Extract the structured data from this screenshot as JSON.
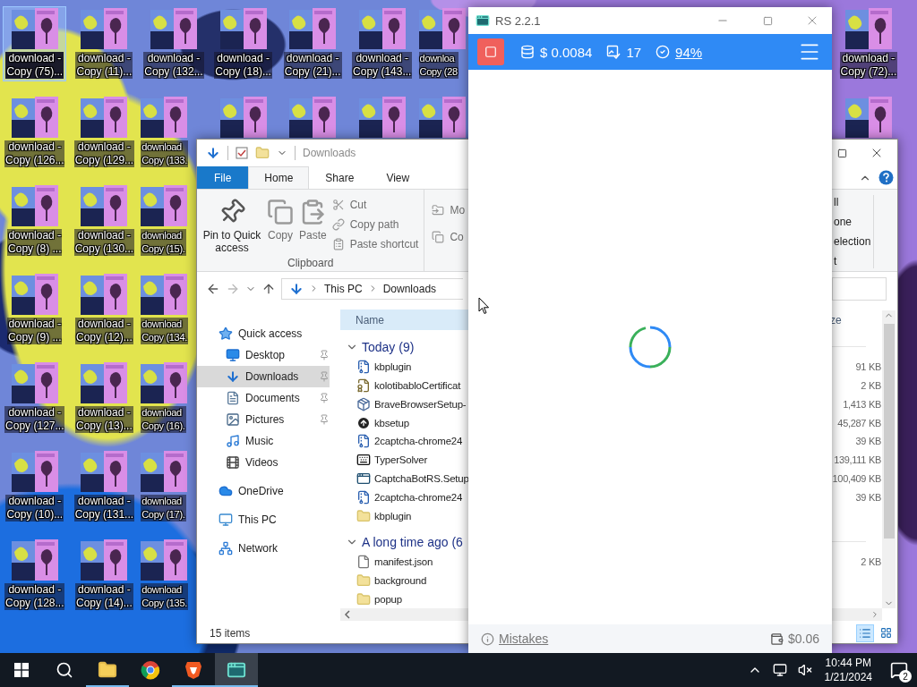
{
  "desktop": {
    "icons": [
      {
        "line_1": "download -",
        "line_2": "Copy (75)...",
        "selected": true
      },
      {
        "line_1": "download -",
        "line_2": "Copy (11)...",
        "selected": false
      },
      {
        "line_1": "download -",
        "line_2": "Copy (132...",
        "selected": false
      },
      {
        "line_1": "download -",
        "line_2": "Copy (18)...",
        "selected": false
      },
      {
        "line_1": "download -",
        "line_2": "Copy (21)...",
        "selected": false
      },
      {
        "line_1": "download -",
        "line_2": "Copy (143...",
        "selected": false
      },
      {
        "line_1": "downloa",
        "line_2": "Copy (28",
        "selected": false
      },
      {
        "line_1": "download -",
        "line_2": "Copy (72)...",
        "selected": false
      },
      {
        "line_1": "download -",
        "line_2": "Copy (126...",
        "selected": false
      },
      {
        "line_1": "download -",
        "line_2": "Copy (129...",
        "selected": false
      },
      {
        "line_1": "download",
        "line_2": "Copy (133.",
        "selected": false
      },
      {
        "selected": false
      },
      {
        "selected": false
      },
      {
        "selected": false
      },
      {
        "selected": false
      },
      {
        "selected": false
      },
      {
        "line_1": "download -",
        "line_2": "Copy (8) ...",
        "selected": false
      },
      {
        "line_1": "download -",
        "line_2": "Copy (130...",
        "selected": false
      },
      {
        "line_1": "download",
        "line_2": "Copy (15).",
        "selected": false
      },
      {
        "line_1": "download -",
        "line_2": "Copy (9) ...",
        "selected": false
      },
      {
        "line_1": "download -",
        "line_2": "Copy (12)...",
        "selected": false
      },
      {
        "line_1": "download",
        "line_2": "Copy (134.",
        "selected": false
      },
      {
        "line_1": "download -",
        "line_2": "Copy (127...",
        "selected": false
      },
      {
        "line_1": "download -",
        "line_2": "Copy (13)...",
        "selected": false
      },
      {
        "line_1": "download",
        "line_2": "Copy (16).",
        "selected": false
      },
      {
        "line_1": "download -",
        "line_2": "Copy (10)...",
        "selected": false
      },
      {
        "line_1": "download -",
        "line_2": "Copy (131...",
        "selected": false
      },
      {
        "line_1": "download",
        "line_2": "Copy (17).",
        "selected": false
      },
      {
        "line_1": "download -",
        "line_2": "Copy (128...",
        "selected": false
      },
      {
        "line_1": "download -",
        "line_2": "Copy (14)...",
        "selected": false
      },
      {
        "line_1": "download",
        "line_2": "Copy (135.",
        "selected": false
      }
    ]
  },
  "explorer": {
    "title": "Downloads",
    "tabs": [
      {
        "label": "File",
        "kind": "file",
        "selected": false
      },
      {
        "label": "Home",
        "kind": "tab",
        "selected": true
      },
      {
        "label": "Share",
        "kind": "tab",
        "selected": false
      },
      {
        "label": "View",
        "kind": "tab",
        "selected": false
      }
    ],
    "ribbon": {
      "large_buttons": [
        {
          "label": "Pin to Quick access",
          "kind": "pin",
          "disabled": false
        },
        {
          "label": "Copy",
          "kind": "copy",
          "disabled": true
        },
        {
          "label": "Paste",
          "kind": "paste",
          "disabled": true
        }
      ],
      "small_buttons": [
        {
          "label": "Cut",
          "kind": "cut",
          "disabled": true
        },
        {
          "label": "Copy path",
          "kind": "path",
          "disabled": true
        },
        {
          "label": "Paste shortcut",
          "kind": "shortcut",
          "disabled": true
        }
      ],
      "group_label": "Clipboard",
      "next_buttons": [
        {
          "label": "Mo",
          "kind": "move"
        },
        {
          "label": "Co",
          "kind": "copy"
        }
      ],
      "right_texts": [
        "ll",
        "one",
        "election",
        "t"
      ]
    },
    "address": {
      "path": [
        "This PC",
        "Downloads"
      ]
    },
    "nav": [
      {
        "label": "Quick access",
        "kind": "star",
        "selected": false,
        "children": [
          {
            "label": "Desktop",
            "kind": "desktop",
            "pinned": true,
            "selected": false
          },
          {
            "label": "Downloads",
            "kind": "downloads",
            "pinned": true,
            "selected": true
          },
          {
            "label": "Documents",
            "kind": "documents",
            "pinned": true,
            "selected": false
          },
          {
            "label": "Pictures",
            "kind": "pictures",
            "pinned": true,
            "selected": false
          },
          {
            "label": "Music",
            "kind": "music",
            "pinned": false,
            "selected": false
          },
          {
            "label": "Videos",
            "kind": "videos",
            "pinned": false,
            "selected": false
          }
        ]
      },
      {
        "label": "OneDrive",
        "kind": "cloud",
        "selected": false
      },
      {
        "label": "This PC",
        "kind": "pc",
        "selected": false
      },
      {
        "label": "Network",
        "kind": "network",
        "selected": false
      }
    ],
    "columns": {
      "name": "Name",
      "size": "ze"
    },
    "groups": [
      {
        "label": "Today (9)",
        "expanded": true,
        "files": [
          {
            "name": "kbplugin",
            "kind": "zip",
            "size": "91 KB"
          },
          {
            "name": "kolotibabloCertificat",
            "kind": "certificate",
            "size": "2 KB"
          },
          {
            "name": "BraveBrowserSetup-",
            "kind": "setup",
            "size": "1,413 KB"
          },
          {
            "name": "kbsetup",
            "kind": "circle",
            "size": "45,287 KB"
          },
          {
            "name": "2captcha-chrome24",
            "kind": "zip",
            "size": "39 KB"
          },
          {
            "name": "TyperSolver",
            "kind": "keyboard",
            "size": "139,111 KB"
          },
          {
            "name": "CaptchaBotRS.Setup",
            "kind": "app",
            "size": "100,409 KB"
          },
          {
            "name": "2captcha-chrome24",
            "kind": "zip",
            "size": "39 KB"
          },
          {
            "name": "kbplugin",
            "kind": "folder"
          }
        ]
      },
      {
        "label": "A long time ago (6",
        "expanded": true,
        "files": [
          {
            "name": "manifest.json",
            "kind": "file",
            "size": "2 KB"
          },
          {
            "name": "background",
            "kind": "folder"
          },
          {
            "name": "popup",
            "kind": "folder"
          }
        ]
      }
    ],
    "status": "15 items",
    "views": [
      {
        "kind": "details",
        "selected": true
      },
      {
        "kind": "tiles",
        "selected": false
      }
    ]
  },
  "rs": {
    "title": "RS 2.2.1",
    "balance": "$ 0.0084",
    "solved": "17",
    "accuracy": "94%",
    "mistakes": "Mistakes",
    "earned": "$0.06"
  },
  "taskbar": {
    "apps": [
      {
        "kind": "folder",
        "open": true,
        "active": false
      },
      {
        "kind": "browser",
        "open": false,
        "active": false
      },
      {
        "kind": "shield",
        "open": true,
        "active": false
      },
      {
        "kind": "app",
        "open": true,
        "active": true
      }
    ],
    "time": "10:44 PM",
    "date": "1/21/2024",
    "notifications": "2"
  }
}
